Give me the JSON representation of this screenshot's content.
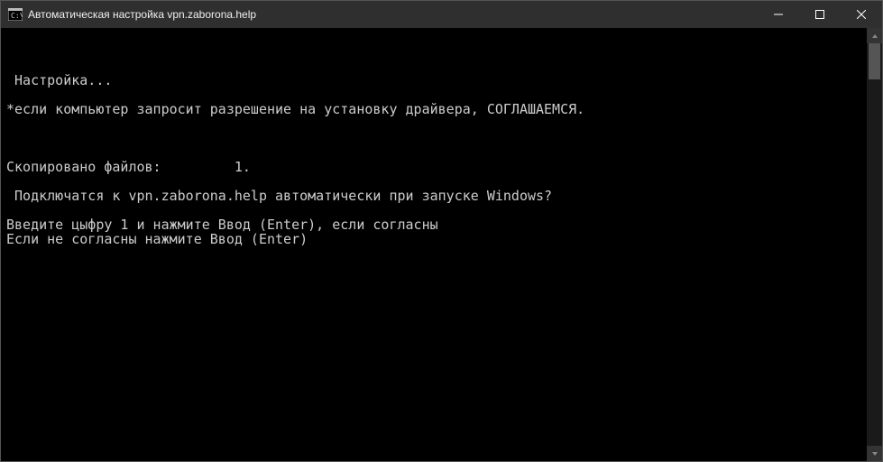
{
  "window": {
    "title": "Автоматическая настройка vpn.zaborona.help"
  },
  "console": {
    "lines": [
      "",
      "",
      "",
      " Настройка...",
      "",
      "*если компьютер запросит разрешение на установку драйвера, СОГЛАШАЕМСЯ.",
      "",
      "",
      "",
      "Скопировано файлов:         1.",
      "",
      " Подключатся к vpn.zaborona.help автоматически при запуске Windows?",
      "",
      "Введите цыфру 1 и нажмите Ввод (Enter), если согласны",
      "Если не согласны нажмите Ввод (Enter)"
    ]
  }
}
